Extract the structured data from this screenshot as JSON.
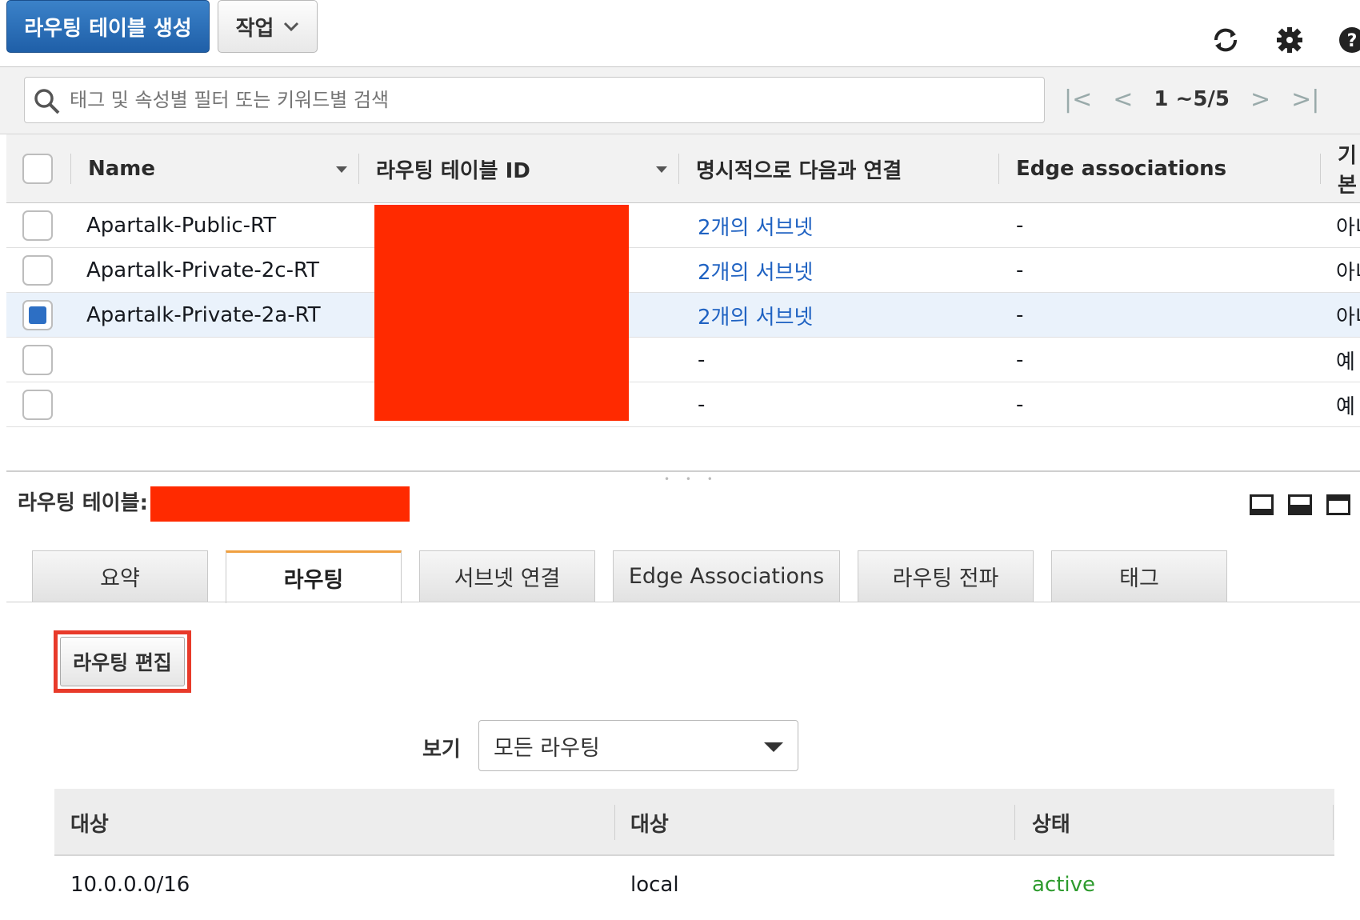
{
  "toolbar": {
    "create_label": "라우팅 테이블 생성",
    "actions_label": "작업"
  },
  "search": {
    "placeholder": "태그 및 속성별 필터 또는 키워드별 검색"
  },
  "pager": {
    "range": "1 ~5/5"
  },
  "table": {
    "columns": [
      "Name",
      "라우팅 테이블 ID",
      "명시적으로 다음과 연결",
      "Edge associations",
      "기본"
    ],
    "rows": [
      {
        "name": "Apartalk-Public-RT",
        "explicit": "2개의 서브넷",
        "edge": "-",
        "main": "아니",
        "selected": false
      },
      {
        "name": "Apartalk-Private-2c-RT",
        "explicit": "2개의 서브넷",
        "edge": "-",
        "main": "아니",
        "selected": false
      },
      {
        "name": "Apartalk-Private-2a-RT",
        "explicit": "2개의 서브넷",
        "edge": "-",
        "main": "아니",
        "selected": true
      },
      {
        "name": "",
        "explicit": "-",
        "edge": "-",
        "main": "예",
        "selected": false
      },
      {
        "name": "",
        "explicit": "-",
        "edge": "-",
        "main": "예",
        "selected": false
      }
    ]
  },
  "detail": {
    "label": "라우팅 테이블:",
    "tabs": [
      "요약",
      "라우팅",
      "서브넷 연결",
      "Edge Associations",
      "라우팅 전파",
      "태그"
    ],
    "active_tab": "라우팅",
    "edit_routes_label": "라우팅 편집",
    "view_label": "보기",
    "view_value": "모든 라우팅",
    "routes": {
      "columns": [
        "대상",
        "대상",
        "상태"
      ],
      "rows": [
        {
          "destination": "10.0.0.0/16",
          "target": "local",
          "status": "active"
        }
      ]
    }
  },
  "colors": {
    "primary": "#1f5fa8",
    "link": "#1f62c2",
    "active_status": "#2e9b2e",
    "redaction": "#ff2a00",
    "tab_accent": "#f0a040"
  }
}
